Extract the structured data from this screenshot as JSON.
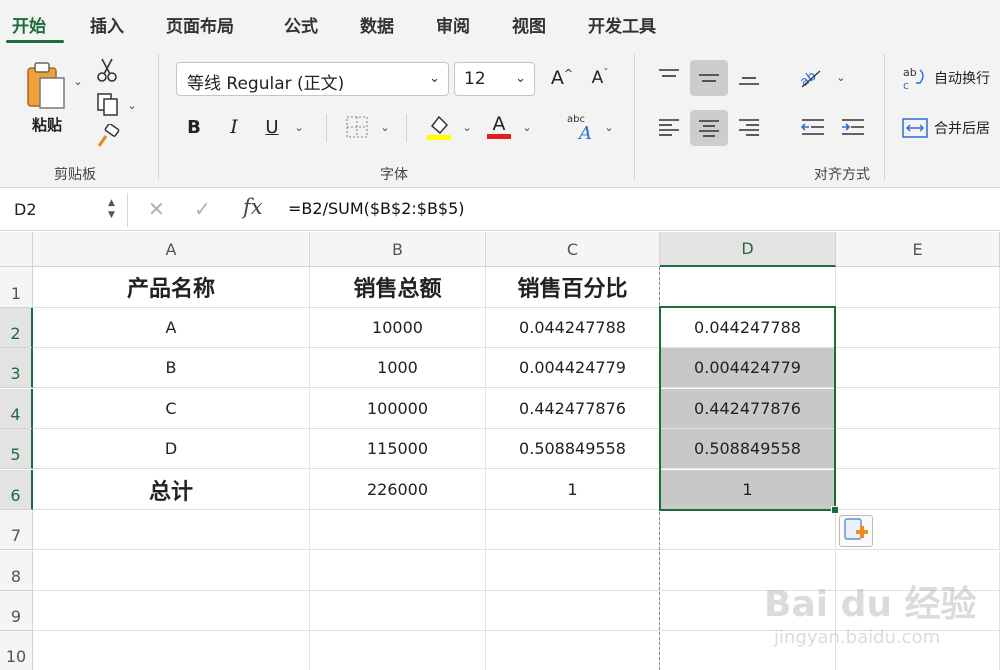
{
  "tabs": [
    {
      "label": "开始",
      "active": true
    },
    {
      "label": "插入"
    },
    {
      "label": "页面布局"
    },
    {
      "label": "公式"
    },
    {
      "label": "数据"
    },
    {
      "label": "审阅"
    },
    {
      "label": "视图"
    },
    {
      "label": "开发工具"
    }
  ],
  "ribbon": {
    "paste_label": "粘贴",
    "clipboard_group": "剪贴板",
    "font_group": "字体",
    "alignment_group": "对齐方式",
    "font_name": "等线 Regular (正文)",
    "font_size": "12",
    "bold_label": "B",
    "italic_label": "I",
    "underline_label": "U",
    "grow_font_label": "A",
    "shrink_font_label": "A",
    "font_color_label": "A",
    "highlight_color": "#ffff00",
    "font_color": "#e02020",
    "wrap_text_label": "自动换行",
    "merge_label": "合并后居"
  },
  "formula_bar": {
    "name_box": "D2",
    "fx_label": "fx",
    "formula": "=B2/SUM($B$2:$B$5)"
  },
  "grid": {
    "columns": [
      "A",
      "B",
      "C",
      "D",
      "E"
    ],
    "selected_column": "D",
    "rows": [
      "1",
      "2",
      "3",
      "4",
      "5",
      "6",
      "7",
      "8",
      "9",
      "10"
    ],
    "cells": {
      "A1": "产品名称",
      "B1": "销售总额",
      "C1": "销售百分比",
      "D1": "",
      "A2": "A",
      "B2": "10000",
      "C2": "0.044247788",
      "D2": "0.044247788",
      "A3": "B",
      "B3": "1000",
      "C3": "0.004424779",
      "D3": "0.004424779",
      "A4": "C",
      "B4": "100000",
      "C4": "0.442477876",
      "D4": "0.442477876",
      "A5": "D",
      "B5": "115000",
      "C5": "0.508849558",
      "D5": "0.508849558",
      "A6": "总计",
      "B6": "226000",
      "C6": "1",
      "D6": "1"
    }
  },
  "watermark": {
    "brand": "Bai du 经验",
    "url": "jingyan.baidu.com"
  },
  "colors": {
    "accent": "#1e6b3c",
    "selection_shade": "#c8c8c8"
  }
}
